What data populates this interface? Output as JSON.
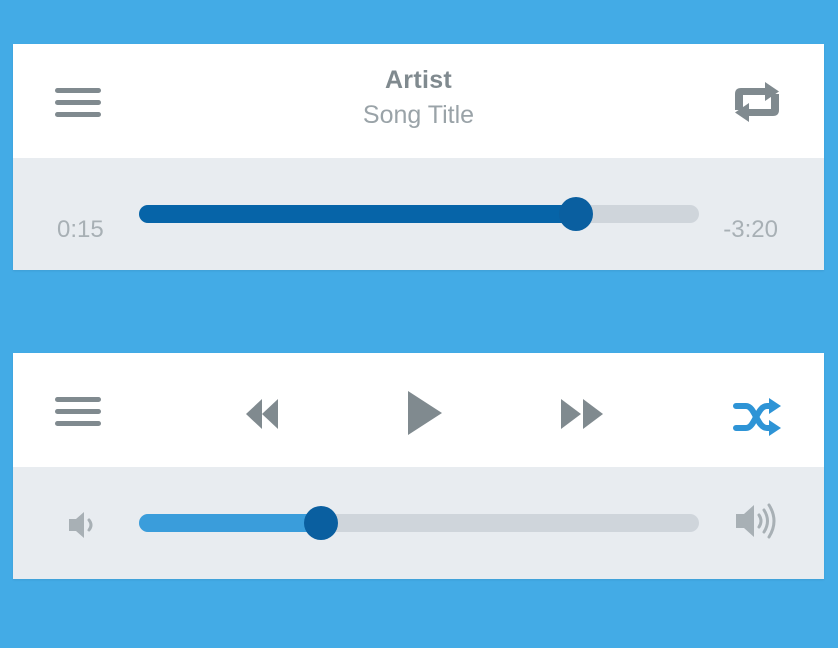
{
  "player_top": {
    "artist": "Artist",
    "song_title": "Song Title",
    "elapsed_time": "0:15",
    "remaining_time": "-3:20",
    "progress": 0.78
  },
  "player_bottom": {
    "volume": 0.325,
    "shuffle_active": true
  },
  "icons": {
    "menu": "menu-icon",
    "repeat": "repeat-icon",
    "rewind": "rewind-icon",
    "play": "play-icon",
    "fast_forward": "fast-forward-icon",
    "shuffle": "shuffle-icon",
    "volume_low": "volume-low-icon",
    "volume_high": "volume-high-icon"
  },
  "colors": {
    "background": "#43abe6",
    "icon_gray": "#808a8f",
    "accent_dark": "#0664a8",
    "accent_light": "#3a9ddb",
    "shuffle_active": "#2e94d6",
    "track": "#cfd5db"
  }
}
